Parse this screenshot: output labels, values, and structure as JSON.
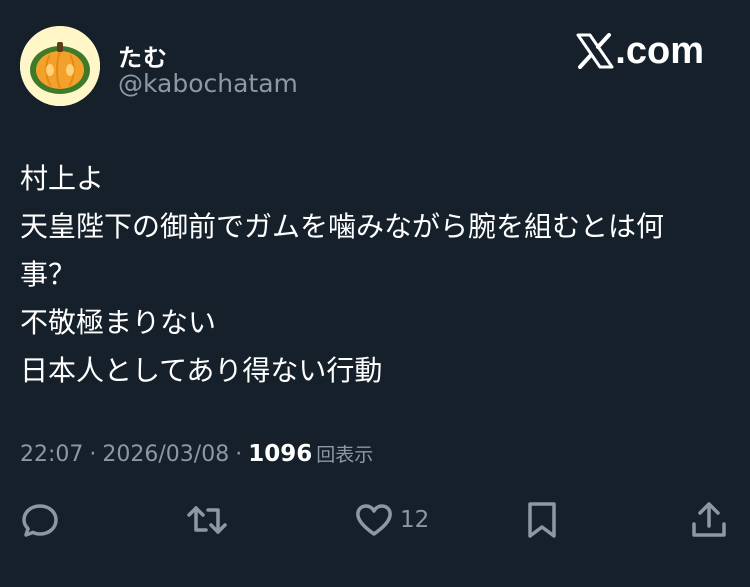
{
  "author": {
    "display_name": "たむ",
    "handle": "@kabochatam",
    "avatar_icon": "pumpkin-icon"
  },
  "brand": {
    "logo_icon": "x-logo-icon",
    "text": ".com"
  },
  "tweet": {
    "lines": [
      "村上よ",
      "天皇陛下の御前でガムを噛みながら腕を組むとは何",
      "事？",
      "不敬極まりない",
      "日本人としてあり得ない行動"
    ]
  },
  "meta": {
    "time": "22:07",
    "separator": "·",
    "date": "2026/03/08",
    "views": "1096",
    "views_label": "回表示"
  },
  "actions": {
    "reply_icon": "reply-icon",
    "retweet_icon": "retweet-icon",
    "like_icon": "heart-icon",
    "like_count": "12",
    "bookmark_icon": "bookmark-icon",
    "share_icon": "share-icon"
  },
  "colors": {
    "background": "#15202b",
    "text": "#ffffff",
    "secondary": "#8b98a5",
    "pumpkin_green": "#3f7a2a",
    "pumpkin_orange": "#f3a12b"
  }
}
